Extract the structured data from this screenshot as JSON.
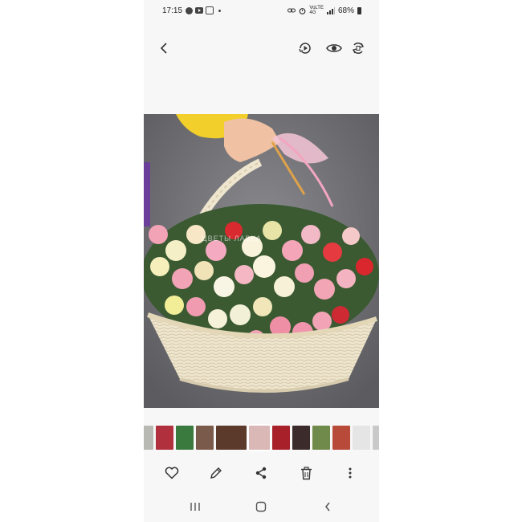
{
  "status_bar": {
    "time": "17:15",
    "network_top": "VoLTE",
    "network_bottom": "4G",
    "battery": "68%"
  },
  "gallery_toolbar": {
    "back_icon": "chevron-left-icon",
    "remaster_icon": "remaster-icon",
    "bixby_vision_icon": "eye-icon",
    "rotate_icon": "auto-rotate-icon"
  },
  "photo": {
    "description_icon": "flower-basket-photo",
    "watermark": "ЦВЕТЫ ЛАВКА",
    "colors": {
      "ground": "#6a6a6e",
      "basket": "#efe6cf",
      "jacket": "#f2cf2a"
    }
  },
  "filmstrip": {
    "thumb_colors": [
      "#b9b9b3",
      "#b1303e",
      "#3a7a3e",
      "#7a5a4a",
      "#5b3a2c",
      "#d9b8b5",
      "#a8202a",
      "#3b2b2b",
      "#6f8a4a",
      "#b84a3a",
      "#e5e5e5",
      "#c9c9c9"
    ],
    "selected_index": 5
  },
  "actions": {
    "favorite_icon": "heart-icon",
    "edit_icon": "pencil-icon",
    "share_icon": "share-icon",
    "delete_icon": "trash-icon",
    "more_icon": "more-vertical-icon"
  },
  "navigation": {
    "recents_icon": "recents-icon",
    "home_icon": "home-icon",
    "back_icon": "back-icon"
  }
}
